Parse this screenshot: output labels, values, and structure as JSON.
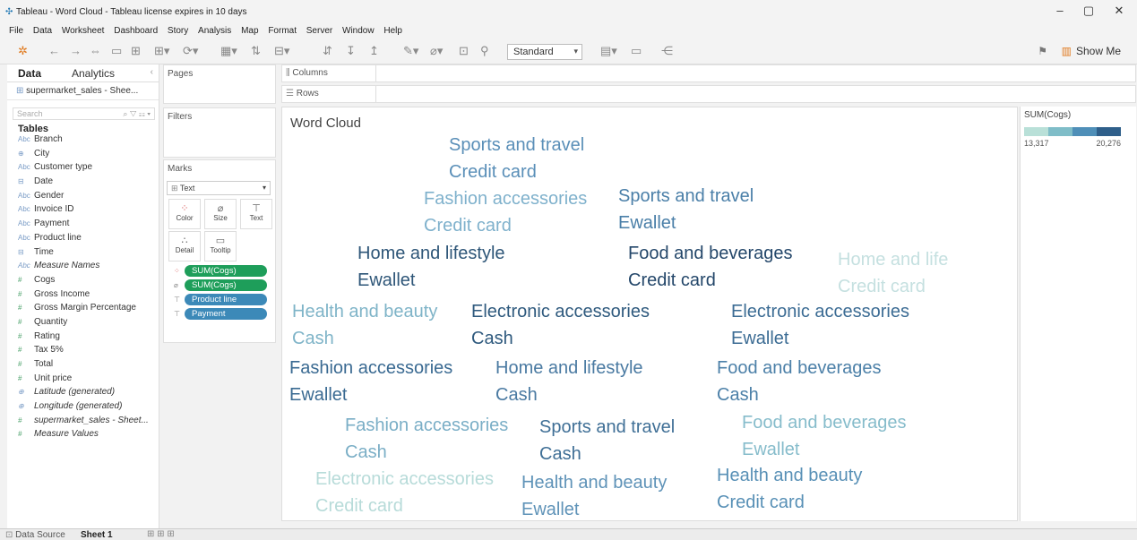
{
  "titlebar": {
    "title": "Tableau - Word Cloud - Tableau license expires in 10 days"
  },
  "menu": [
    "File",
    "Data",
    "Worksheet",
    "Dashboard",
    "Story",
    "Analysis",
    "Map",
    "Format",
    "Server",
    "Window",
    "Help"
  ],
  "toolbar": {
    "fit_value": "Standard",
    "show_me": "Show Me"
  },
  "left_panel": {
    "tab_data": "Data",
    "tab_analytics": "Analytics",
    "datasource": "supermarket_sales - Shee...",
    "search_placeholder": "Search",
    "tables_header": "Tables",
    "fields": [
      {
        "name": "Branch",
        "kind": "dim"
      },
      {
        "name": "City",
        "kind": "geo"
      },
      {
        "name": "Customer type",
        "kind": "dim"
      },
      {
        "name": "Date",
        "kind": "date"
      },
      {
        "name": "Gender",
        "kind": "dim"
      },
      {
        "name": "Invoice ID",
        "kind": "dim"
      },
      {
        "name": "Payment",
        "kind": "dim"
      },
      {
        "name": "Product line",
        "kind": "dim"
      },
      {
        "name": "Time",
        "kind": "date"
      },
      {
        "name": "Measure Names",
        "kind": "dim"
      },
      {
        "name": "Cogs",
        "kind": "measure"
      },
      {
        "name": "Gross Income",
        "kind": "measure"
      },
      {
        "name": "Gross Margin Percentage",
        "kind": "measure"
      },
      {
        "name": "Quantity",
        "kind": "measure"
      },
      {
        "name": "Rating",
        "kind": "measure"
      },
      {
        "name": "Tax 5%",
        "kind": "measure"
      },
      {
        "name": "Total",
        "kind": "measure"
      },
      {
        "name": "Unit price",
        "kind": "measure"
      },
      {
        "name": "Latitude (generated)",
        "kind": "geo"
      },
      {
        "name": "Longitude (generated)",
        "kind": "geo"
      },
      {
        "name": "supermarket_sales - Sheet...",
        "kind": "measure"
      },
      {
        "name": "Measure Values",
        "kind": "measure"
      }
    ]
  },
  "cards": {
    "pages": "Pages",
    "filters": "Filters",
    "marks": "Marks",
    "mark_type": "Text",
    "mark_buttons": [
      "Color",
      "Size",
      "Text",
      "Detail",
      "Tooltip"
    ],
    "pills": [
      "SUM(Cogs)",
      "SUM(Cogs)",
      "Product line",
      "Payment"
    ]
  },
  "shelves": {
    "columns": "Columns",
    "rows": "Rows"
  },
  "view": {
    "title": "Word Cloud",
    "words": [
      {
        "line1": "Sports and travel",
        "line2": "Credit card",
        "color": "#5a8fb8"
      },
      {
        "line1": "Fashion accessories",
        "line2": "Credit card",
        "color": "#7fb1cc"
      },
      {
        "line1": "Sports and travel",
        "line2": "Ewallet",
        "color": "#4a7fa8"
      },
      {
        "line1": "Home and lifestyle",
        "line2": "Ewallet",
        "color": "#2e5678"
      },
      {
        "line1": "Food and beverages",
        "line2": "Credit card",
        "color": "#24476a"
      },
      {
        "line1": "Home and life",
        "line2": "Credit card",
        "color": "#c5e0e0"
      },
      {
        "line1": "Health and beauty",
        "line2": "Cash",
        "color": "#7fb4c8"
      },
      {
        "line1": "Electronic accessories",
        "line2": "Cash",
        "color": "#2f5a7e"
      },
      {
        "line1": "Electronic accessories",
        "line2": "Ewallet",
        "color": "#3c6c94"
      },
      {
        "line1": "Fashion accessories",
        "line2": "Ewallet",
        "color": "#3a6a92"
      },
      {
        "line1": "Home and lifestyle",
        "line2": "Cash",
        "color": "#4a7aa2"
      },
      {
        "line1": "Food and beverages",
        "line2": "Cash",
        "color": "#4c80a8"
      },
      {
        "line1": "Fashion accessories",
        "line2": "Cash",
        "color": "#7aaec6"
      },
      {
        "line1": "Sports and travel",
        "line2": "Cash",
        "color": "#3f6f96"
      },
      {
        "line1": "Food and beverages",
        "line2": "Ewallet",
        "color": "#86bccb"
      },
      {
        "line1": "Electronic accessories",
        "line2": "Credit card",
        "color": "#b7dbd9"
      },
      {
        "line1": "Health and beauty",
        "line2": "Ewallet",
        "color": "#5f93b8"
      },
      {
        "line1": "Health and beauty",
        "line2": "Credit card",
        "color": "#5890b6"
      }
    ]
  },
  "legend": {
    "title": "SUM(Cogs)",
    "min": "13,317",
    "max": "20,276",
    "colors": [
      "#b9e0d8",
      "#7fbdc8",
      "#4f8fb8",
      "#2f5f8a"
    ]
  },
  "status": {
    "data_source": "Data Source",
    "sheet": "Sheet 1"
  }
}
